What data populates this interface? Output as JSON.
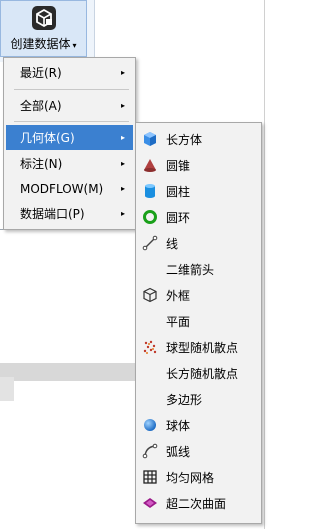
{
  "ribbon": {
    "button_label": "创建数据体",
    "caret": "▾"
  },
  "menu1": {
    "items": [
      {
        "label": "最近(R)",
        "arrow": "▸"
      },
      {
        "label": "全部(A)",
        "arrow": "▸"
      },
      {
        "label": "几何体(G)",
        "arrow": "▸"
      },
      {
        "label": "标注(N)",
        "arrow": "▸"
      },
      {
        "label": "MODFLOW(M)",
        "arrow": "▸"
      },
      {
        "label": "数据端口(P)",
        "arrow": "▸"
      }
    ]
  },
  "menu2": {
    "items": [
      {
        "label": "长方体",
        "icon": "cube-icon"
      },
      {
        "label": "圆锥",
        "icon": "cone-icon"
      },
      {
        "label": "圆柱",
        "icon": "cylinder-icon"
      },
      {
        "label": "圆环",
        "icon": "torus-icon"
      },
      {
        "label": "线",
        "icon": "line-icon"
      },
      {
        "label": "二维箭头",
        "icon": ""
      },
      {
        "label": "外框",
        "icon": "bounding-box-icon"
      },
      {
        "label": "平面",
        "icon": ""
      },
      {
        "label": "球型随机散点",
        "icon": "scatter-points-icon"
      },
      {
        "label": "长方随机散点",
        "icon": ""
      },
      {
        "label": "多边形",
        "icon": ""
      },
      {
        "label": "球体",
        "icon": "sphere-icon"
      },
      {
        "label": "弧线",
        "icon": "arc-icon"
      },
      {
        "label": "均匀网格",
        "icon": "grid-icon"
      },
      {
        "label": "超二次曲面",
        "icon": "superquadric-icon"
      }
    ]
  },
  "colors": {
    "selected": "#3b80d0",
    "menu_bg": "#f2f2f2",
    "ribbon_bg": "#d9e7f7"
  }
}
